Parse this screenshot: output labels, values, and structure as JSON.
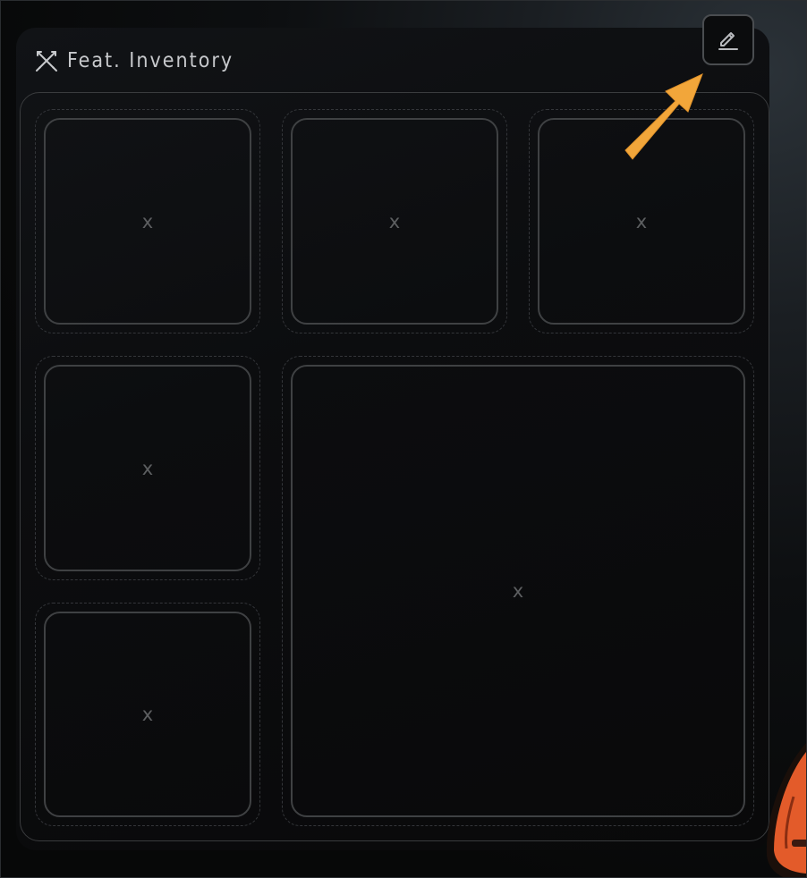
{
  "panel": {
    "title": "Feat. Inventory",
    "title_icon": "crossed-swords-icon",
    "edit_icon": "pencil-edit-icon"
  },
  "slots": [
    {
      "label": "x"
    },
    {
      "label": "x"
    },
    {
      "label": "x"
    },
    {
      "label": "x"
    },
    {
      "label": "x"
    },
    {
      "label": "x"
    }
  ],
  "colors": {
    "accent_arrow": "#F2A63A",
    "mascot_orange": "#E35B2A"
  }
}
